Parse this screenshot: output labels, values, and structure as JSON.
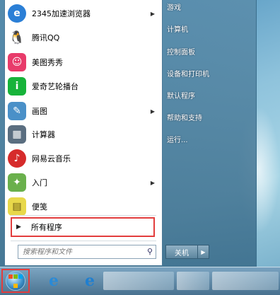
{
  "programs": [
    {
      "label": "2345加速浏览器",
      "icon": "browser-2345-icon",
      "color": "#2b7fd6",
      "glyph": "e",
      "arrow": "▶"
    },
    {
      "label": "腾讯QQ",
      "icon": "qq-penguin-icon",
      "color": "#222222",
      "glyph": "Q",
      "arrow": ""
    },
    {
      "label": "美图秀秀",
      "icon": "meitu-icon",
      "color": "#e83b6a",
      "glyph": "☺",
      "arrow": ""
    },
    {
      "label": "爱奇艺轮播台",
      "icon": "iqiyi-icon",
      "color": "#17b33a",
      "glyph": "i",
      "arrow": ""
    },
    {
      "label": "画图",
      "icon": "paint-palette-icon",
      "color": "#4a90c8",
      "glyph": "✎",
      "arrow": "▶"
    },
    {
      "label": "计算器",
      "icon": "calculator-icon",
      "color": "#5a6e80",
      "glyph": "▦",
      "arrow": ""
    },
    {
      "label": "网易云音乐",
      "icon": "netease-music-icon",
      "color": "#d62b2b",
      "glyph": "♪",
      "arrow": ""
    },
    {
      "label": "入门",
      "icon": "getting-started-icon",
      "color": "#6ab04c",
      "glyph": "✦",
      "arrow": "▶"
    },
    {
      "label": "便笺",
      "icon": "sticky-notes-icon",
      "color": "#e8d84a",
      "glyph": "▤",
      "arrow": ""
    }
  ],
  "all_programs": {
    "label": "所有程序",
    "arrow": "▶"
  },
  "search": {
    "placeholder": "搜索程序和文件",
    "icon": "search-icon"
  },
  "right_items": [
    "游戏",
    "计算机",
    "控制面板",
    "设备和打印机",
    "默认程序",
    "帮助和支持",
    "运行..."
  ],
  "shutdown": {
    "label": "关机",
    "arrow": "▶"
  },
  "taskbar": {
    "ie_glyph": "e"
  }
}
